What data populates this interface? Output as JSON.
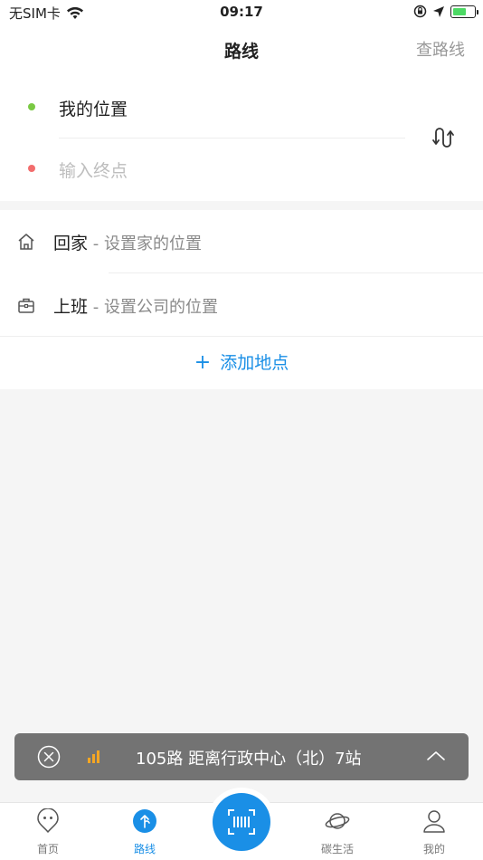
{
  "status_bar": {
    "carrier": "无SIM卡",
    "time": "09:17"
  },
  "nav": {
    "title": "路线",
    "action_label": "查路线"
  },
  "route": {
    "start_label": "我的位置",
    "start_color": "#7ac943",
    "end_placeholder": "输入终点",
    "end_color": "#f26d6d"
  },
  "places": {
    "home_label": "回家",
    "home_hint": " - 设置家的位置",
    "work_label": "上班",
    "work_hint": " - 设置公司的位置",
    "add_label": "添加地点"
  },
  "bus_banner": {
    "text": "105路 距离行政中心（北）7站",
    "signal_color": "#f5a623"
  },
  "tabs": [
    {
      "label": "首页",
      "icon": "home-bubble-icon"
    },
    {
      "label": "路线",
      "icon": "route-icon",
      "active": true
    },
    {
      "label": "",
      "icon": "scan-icon"
    },
    {
      "label": "碳生活",
      "icon": "planet-icon"
    },
    {
      "label": "我的",
      "icon": "user-icon"
    }
  ],
  "colors": {
    "accent": "#1a8fe6",
    "banner_bg": "#737373"
  }
}
